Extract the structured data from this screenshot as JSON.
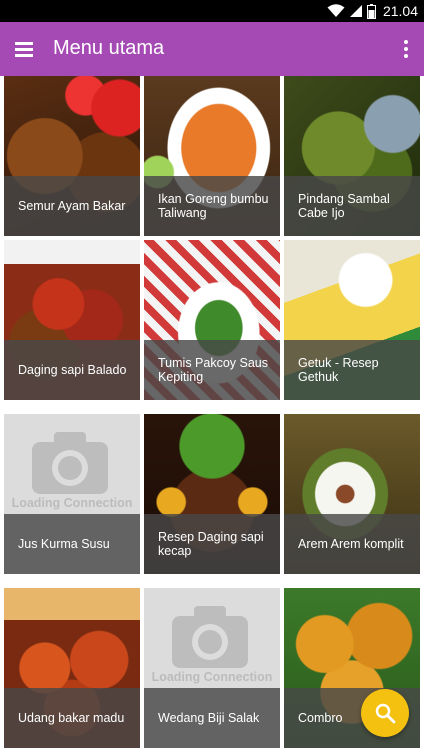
{
  "status_bar": {
    "time": "21.04",
    "icons": [
      "wifi-icon",
      "signal-icon",
      "battery-icon"
    ]
  },
  "app_bar": {
    "title": "Menu utama",
    "icons": [
      "hamburger-menu-icon",
      "more-vert-icon"
    ],
    "color": "#a54ab4"
  },
  "placeholder_text": "Loading Connection",
  "items": [
    {
      "label": "Semur Ayam Bakar"
    },
    {
      "label": "Ikan Goreng bumbu Taliwang"
    },
    {
      "label": "Pindang Sambal Cabe Ijo"
    },
    {
      "label": "Daging sapi Balado"
    },
    {
      "label": "Tumis Pakcoy Saus Kepiting"
    },
    {
      "label": "Getuk - Resep Gethuk"
    },
    {
      "label": "Jus Kurma Susu"
    },
    {
      "label": "Resep Daging sapi kecap"
    },
    {
      "label": "Arem Arem komplit"
    },
    {
      "label": "Udang bakar madu"
    },
    {
      "label": "Wedang Biji Salak"
    },
    {
      "label": "Combro"
    }
  ],
  "fab": {
    "icon": "search-icon",
    "color": "#f5c110"
  }
}
